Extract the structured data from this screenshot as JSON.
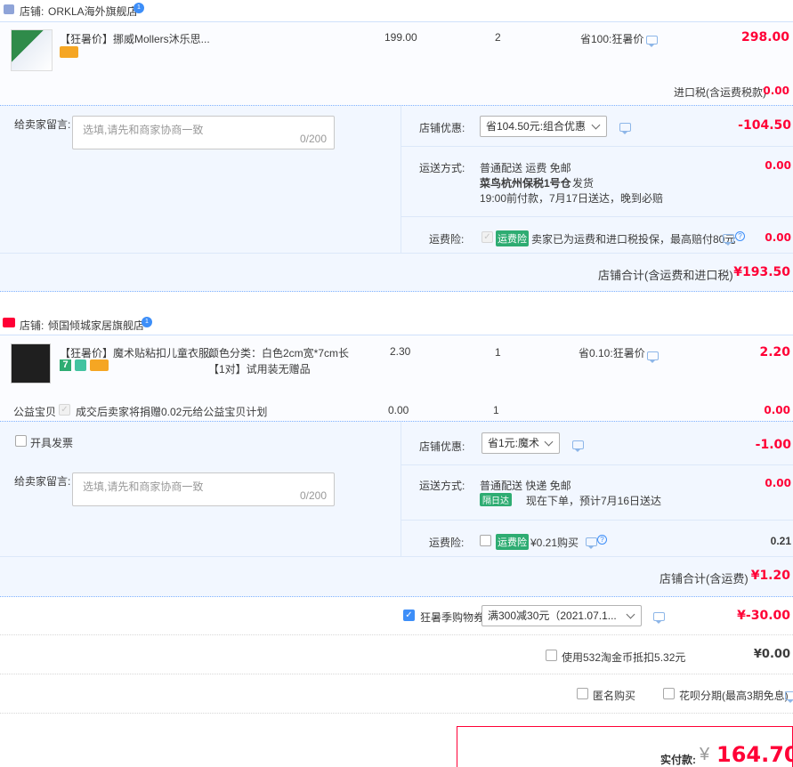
{
  "shop1": {
    "label": "店铺:",
    "name": "ORKLA海外旗舰店",
    "item": {
      "title": "【狂暑价】挪威Mollers沐乐思...",
      "price": "199.00",
      "qty": "2",
      "promo": "省100:狂暑价",
      "subtotal": "298.00"
    },
    "tax_label": "进口税(含运费税款)",
    "tax_value": "0.00",
    "msg_label": "给卖家留言:",
    "msg_placeholder": "选填,请先和商家协商一致",
    "msg_count": "0/200",
    "discount_label": "店铺优惠:",
    "discount_select": "省104.50元:组合优惠",
    "discount_value": "-104.50",
    "ship_label": "运送方式:",
    "ship_line1": "普通配送 运费 免邮",
    "ship_line2": "菜鸟杭州保税1号仓",
    "ship_line2b": "发货",
    "ship_line3": "19:00前付款，7月17日送达，晚到必赔",
    "ship_value": "0.00",
    "ins_label": "运费险:",
    "ins_tag": "运费险",
    "ins_text": "卖家已为运费和进口税投保，最高赔付80元",
    "ins_value": "0.00",
    "total_label": "店铺合计(含运费和进口税)",
    "total_value": "¥193.50"
  },
  "shop2": {
    "label": "店铺:",
    "name": "倾国倾城家居旗舰店",
    "item": {
      "title1": "【狂暑价】魔术贴粘扣儿童衣服...",
      "spec1": "颜色分类：白色2cm宽*7cm长",
      "spec2": "【1对】试用装无赠品",
      "price": "2.30",
      "qty": "1",
      "promo": "省0.10:狂暑价",
      "subtotal": "2.20",
      "tag_seven": "7"
    },
    "charity_label": "公益宝贝",
    "charity_text": "成交后卖家将捐赠0.02元给公益宝贝计划",
    "charity_price": "0.00",
    "charity_qty": "1",
    "charity_value": "0.00",
    "invoice_label": "开具发票",
    "msg_label": "给卖家留言:",
    "msg_placeholder": "选填,请先和商家协商一致",
    "msg_count": "0/200",
    "discount_label": "店铺优惠:",
    "discount_select": "省1元:魔术",
    "discount_value": "-1.00",
    "ship_label": "运送方式:",
    "ship_line1": "普通配送 快递 免邮",
    "ship_tag": "隔日达",
    "ship_line2": "现在下单，预计7月16日送达",
    "ship_value": "0.00",
    "ins_label": "运费险:",
    "ins_tag": "运费险",
    "ins_text": "¥0.21购买",
    "ins_value": "0.21",
    "total_label": "店铺合计(含运费)",
    "total_value": "¥1.20"
  },
  "coupon": {
    "label": "狂暑季购物券",
    "select": "满300减30元（2021.07.1...",
    "value": "¥-30.00"
  },
  "taojinbi": {
    "label": "使用532淘金币抵扣5.32元",
    "value": "¥0.00"
  },
  "anon": {
    "label": "匿名购买"
  },
  "huabei": {
    "label": "花呗分期(最高3期免息)"
  },
  "pay": {
    "label": "实付款:",
    "symbol": "¥",
    "value": "164.70"
  },
  "colors": {
    "accent": "#3d8ef8",
    "price_red": "#ff0036",
    "bg_blue": "#f2f7ff"
  }
}
